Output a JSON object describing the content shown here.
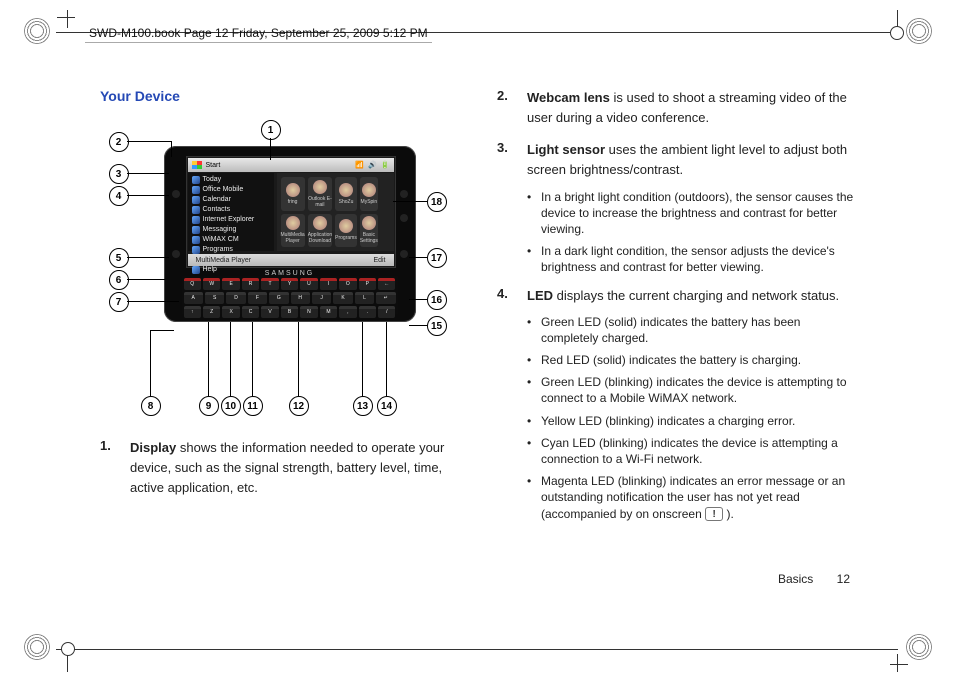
{
  "header_path": "SWD-M100.book  Page 12  Friday, September 25, 2009  5:12 PM",
  "section_title": "Your Device",
  "footer": {
    "section": "Basics",
    "page": "12"
  },
  "device": {
    "start_label": "Start",
    "brand": "SAMSUNG",
    "softkey_left": "MultiMedia Player",
    "softkey_right": "Edit",
    "menu_items": [
      "Today",
      "Office Mobile",
      "Calendar",
      "Contacts",
      "Internet Explorer",
      "Messaging",
      "WiMAX CM",
      "Programs",
      "Settings",
      "Help"
    ],
    "tiles": [
      "fring",
      "Outlook E-mail",
      "ShoZu",
      "MySpin",
      "MultiMedia Player",
      "Application Download",
      "Programs",
      "Basic Settings"
    ],
    "keyboard": {
      "row1": [
        "~",
        "Q",
        "2",
        "W",
        "3",
        "E",
        "4",
        "R",
        "5",
        "T",
        "6",
        "Y",
        "7",
        "U",
        "8",
        "I",
        "9",
        "O",
        "0",
        "P",
        "←"
      ],
      "full_row1": [
        "Q",
        "W",
        "E",
        "R",
        "T",
        "Y",
        "U",
        "I",
        "O",
        "P",
        "←"
      ],
      "row2": [
        "A",
        "S",
        "D",
        "F",
        "G",
        "H",
        "J",
        "K",
        "L",
        "↵"
      ],
      "row3": [
        "↑",
        "Z",
        "X",
        "C",
        "V",
        "B",
        "N",
        "M",
        ",",
        ".",
        "/"
      ]
    }
  },
  "callouts": [
    "1",
    "2",
    "3",
    "4",
    "5",
    "6",
    "7",
    "8",
    "9",
    "10",
    "11",
    "12",
    "13",
    "14",
    "15",
    "16",
    "17",
    "18"
  ],
  "col1_items": [
    {
      "num": "1.",
      "term": "Display",
      "rest": " shows the information needed to operate your device, such as the signal strength, battery level, time, active application, etc."
    }
  ],
  "col2_items": [
    {
      "num": "2.",
      "term": "Webcam lens",
      "rest": " is used to shoot a streaming video of the user during a video conference."
    },
    {
      "num": "3.",
      "term": "Light sensor",
      "rest": " uses the ambient light level to adjust both screen brightness/contrast.",
      "bullets": [
        "In a bright light condition (outdoors), the sensor causes the device to increase the brightness and contrast for better viewing.",
        "In a dark light condition, the sensor adjusts the device's brightness and contrast for better viewing."
      ]
    },
    {
      "num": "4.",
      "term": "LED",
      "rest": " displays the current charging and network status.",
      "bullets": [
        "Green LED (solid) indicates the battery has been completely charged.",
        "Red LED (solid) indicates the battery is charging.",
        "Green LED (blinking) indicates the device is attempting to connect to a Mobile WiMAX network.",
        "Yellow LED (blinking) indicates a charging error.",
        "Cyan LED (blinking) indicates the device is attempting a connection to a Wi-Fi network.",
        "Magenta LED (blinking) indicates an error message or an outstanding notification the user has not yet read (accompanied by on onscreen __ICON__ )."
      ]
    }
  ]
}
